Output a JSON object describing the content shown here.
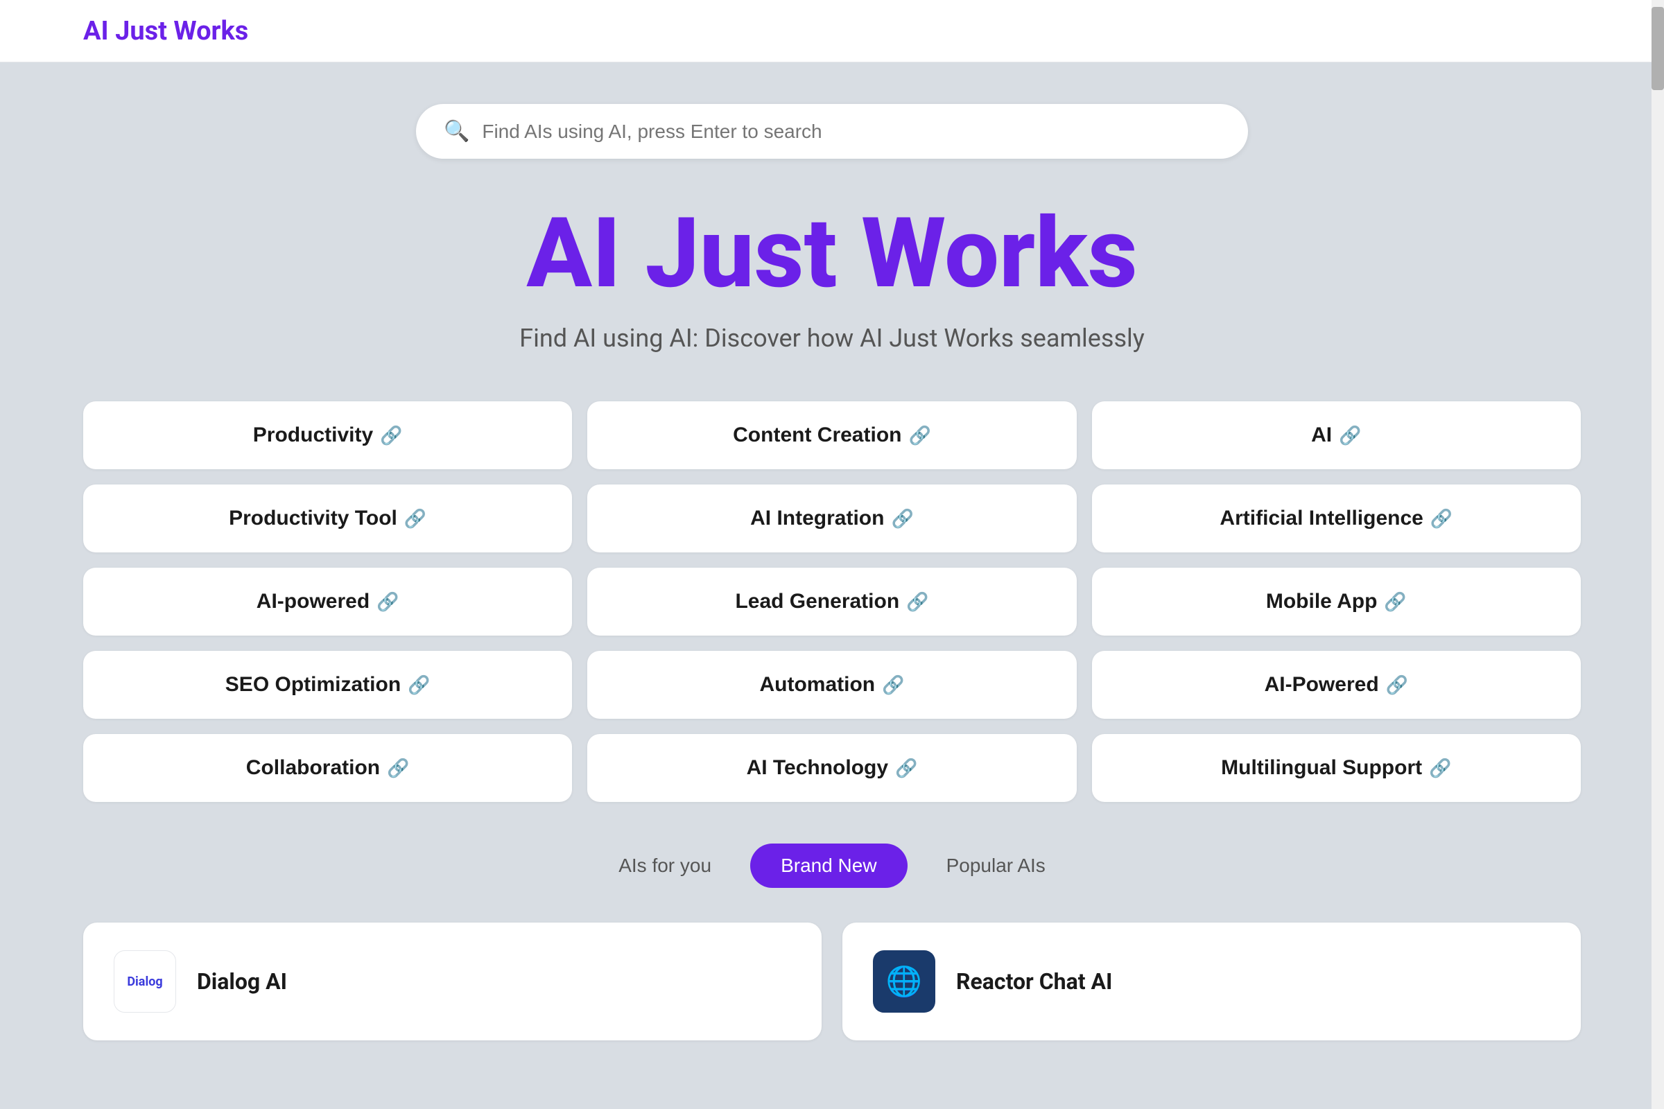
{
  "header": {
    "logo": "AI Just Works"
  },
  "search": {
    "placeholder": "Find AIs using AI, press Enter to search"
  },
  "hero": {
    "title": "AI Just Works",
    "subtitle": "Find AI using AI: Discover how AI Just Works seamlessly"
  },
  "categories": [
    {
      "label": "Productivity",
      "icon": "🔗"
    },
    {
      "label": "Content Creation",
      "icon": "🔗"
    },
    {
      "label": "AI",
      "icon": "🔗"
    },
    {
      "label": "Productivity Tool",
      "icon": "🔗"
    },
    {
      "label": "AI Integration",
      "icon": "🔗"
    },
    {
      "label": "Artificial Intelligence",
      "icon": "🔗"
    },
    {
      "label": "AI-powered",
      "icon": "🔗"
    },
    {
      "label": "Lead Generation",
      "icon": "🔗"
    },
    {
      "label": "Mobile App",
      "icon": "🔗"
    },
    {
      "label": "SEO Optimization",
      "icon": "🔗"
    },
    {
      "label": "Automation",
      "icon": "🔗"
    },
    {
      "label": "AI-Powered",
      "icon": "🔗"
    },
    {
      "label": "Collaboration",
      "icon": "🔗"
    },
    {
      "label": "AI Technology",
      "icon": "🔗"
    },
    {
      "label": "Multilingual Support",
      "icon": "🔗"
    }
  ],
  "tabs": [
    {
      "label": "AIs for you",
      "active": false
    },
    {
      "label": "Brand New",
      "active": true
    },
    {
      "label": "Popular AIs",
      "active": false
    }
  ],
  "ai_cards": [
    {
      "name": "Dialog AI",
      "avatar_type": "dialog",
      "avatar_text": "Dialog"
    },
    {
      "name": "Reactor Chat AI",
      "avatar_type": "reactor",
      "avatar_text": "🌐"
    }
  ]
}
